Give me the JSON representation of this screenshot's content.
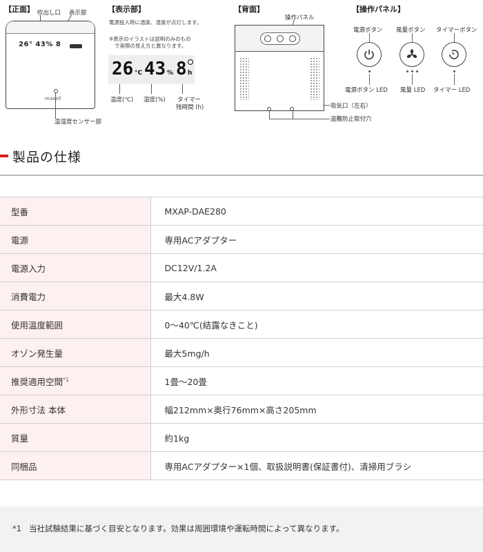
{
  "diagrams": {
    "front": {
      "label": "【正面】",
      "outlet_label": "吹出し口",
      "display_label": "表示部",
      "display_text": "26° 43% 8",
      "brand": "maxell",
      "sensor_label": "温湿度センサー部"
    },
    "display": {
      "label": "【表示部】",
      "note": "電源投入時に温度、湿度が点灯します。",
      "disclaimer_line1": "※表示のイラストは説明のみのもの",
      "disclaimer_line2": "で実際の見え方と異なります。",
      "temp_value": "26",
      "temp_unit": "°C",
      "humidity_value": "43",
      "humidity_unit": "%",
      "timer_value": "8",
      "timer_unit": "h",
      "temp_caption": "温度(℃)",
      "humidity_caption": "湿度(%)",
      "timer_caption_line1": "タイマー",
      "timer_caption_line2": "残時間 (h)"
    },
    "back": {
      "label": "【背面】",
      "panel_label": "操作パネル",
      "intake_label": "吸気口（左右）",
      "theft_label": "盗難防止取付穴"
    },
    "panel": {
      "label": "【操作パネル】",
      "power_button": "電源ボタン",
      "fan_button": "風量ボタン",
      "timer_button": "タイマーボタン",
      "power_led": "電源ボタン LED",
      "fan_led": "風量 LED",
      "timer_led": "タイマー LED"
    },
    "icons": [
      "power-icon",
      "fan-icon",
      "timer-icon"
    ]
  },
  "spec": {
    "heading": "製品の仕様",
    "rows": [
      {
        "label": "型番",
        "value": "MXAP-DAE280"
      },
      {
        "label": "電源",
        "value": "専用ACアダプター"
      },
      {
        "label": "電源入力",
        "value": "DC12V/1.2A"
      },
      {
        "label": "消費電力",
        "value": "最大4.8W"
      },
      {
        "label": "使用温度範囲",
        "value": "0～40℃(結露なきこと)"
      },
      {
        "label": "オゾン発生量",
        "value": "最大5mg/h"
      },
      {
        "label": "推奨適用空間",
        "sup": "*1",
        "value": "1畳～20畳"
      },
      {
        "label": "外形寸法 本体",
        "value": "幅212mm×奥行76mm×高さ205mm"
      },
      {
        "label": "質量",
        "value": "約1kg"
      },
      {
        "label": "同梱品",
        "value": "専用ACアダプター×1個、取扱説明書(保証書付)、清掃用ブラシ"
      }
    ]
  },
  "footnote": {
    "marker": "*1",
    "text": "当社試験結果に基づく目安となります。効果は周囲環境や運転時間によって異なります。"
  },
  "colors": {
    "accent": "#d61f1f",
    "label_bg": "#fdf0f0",
    "footnote_bg": "#f2f2f2"
  }
}
